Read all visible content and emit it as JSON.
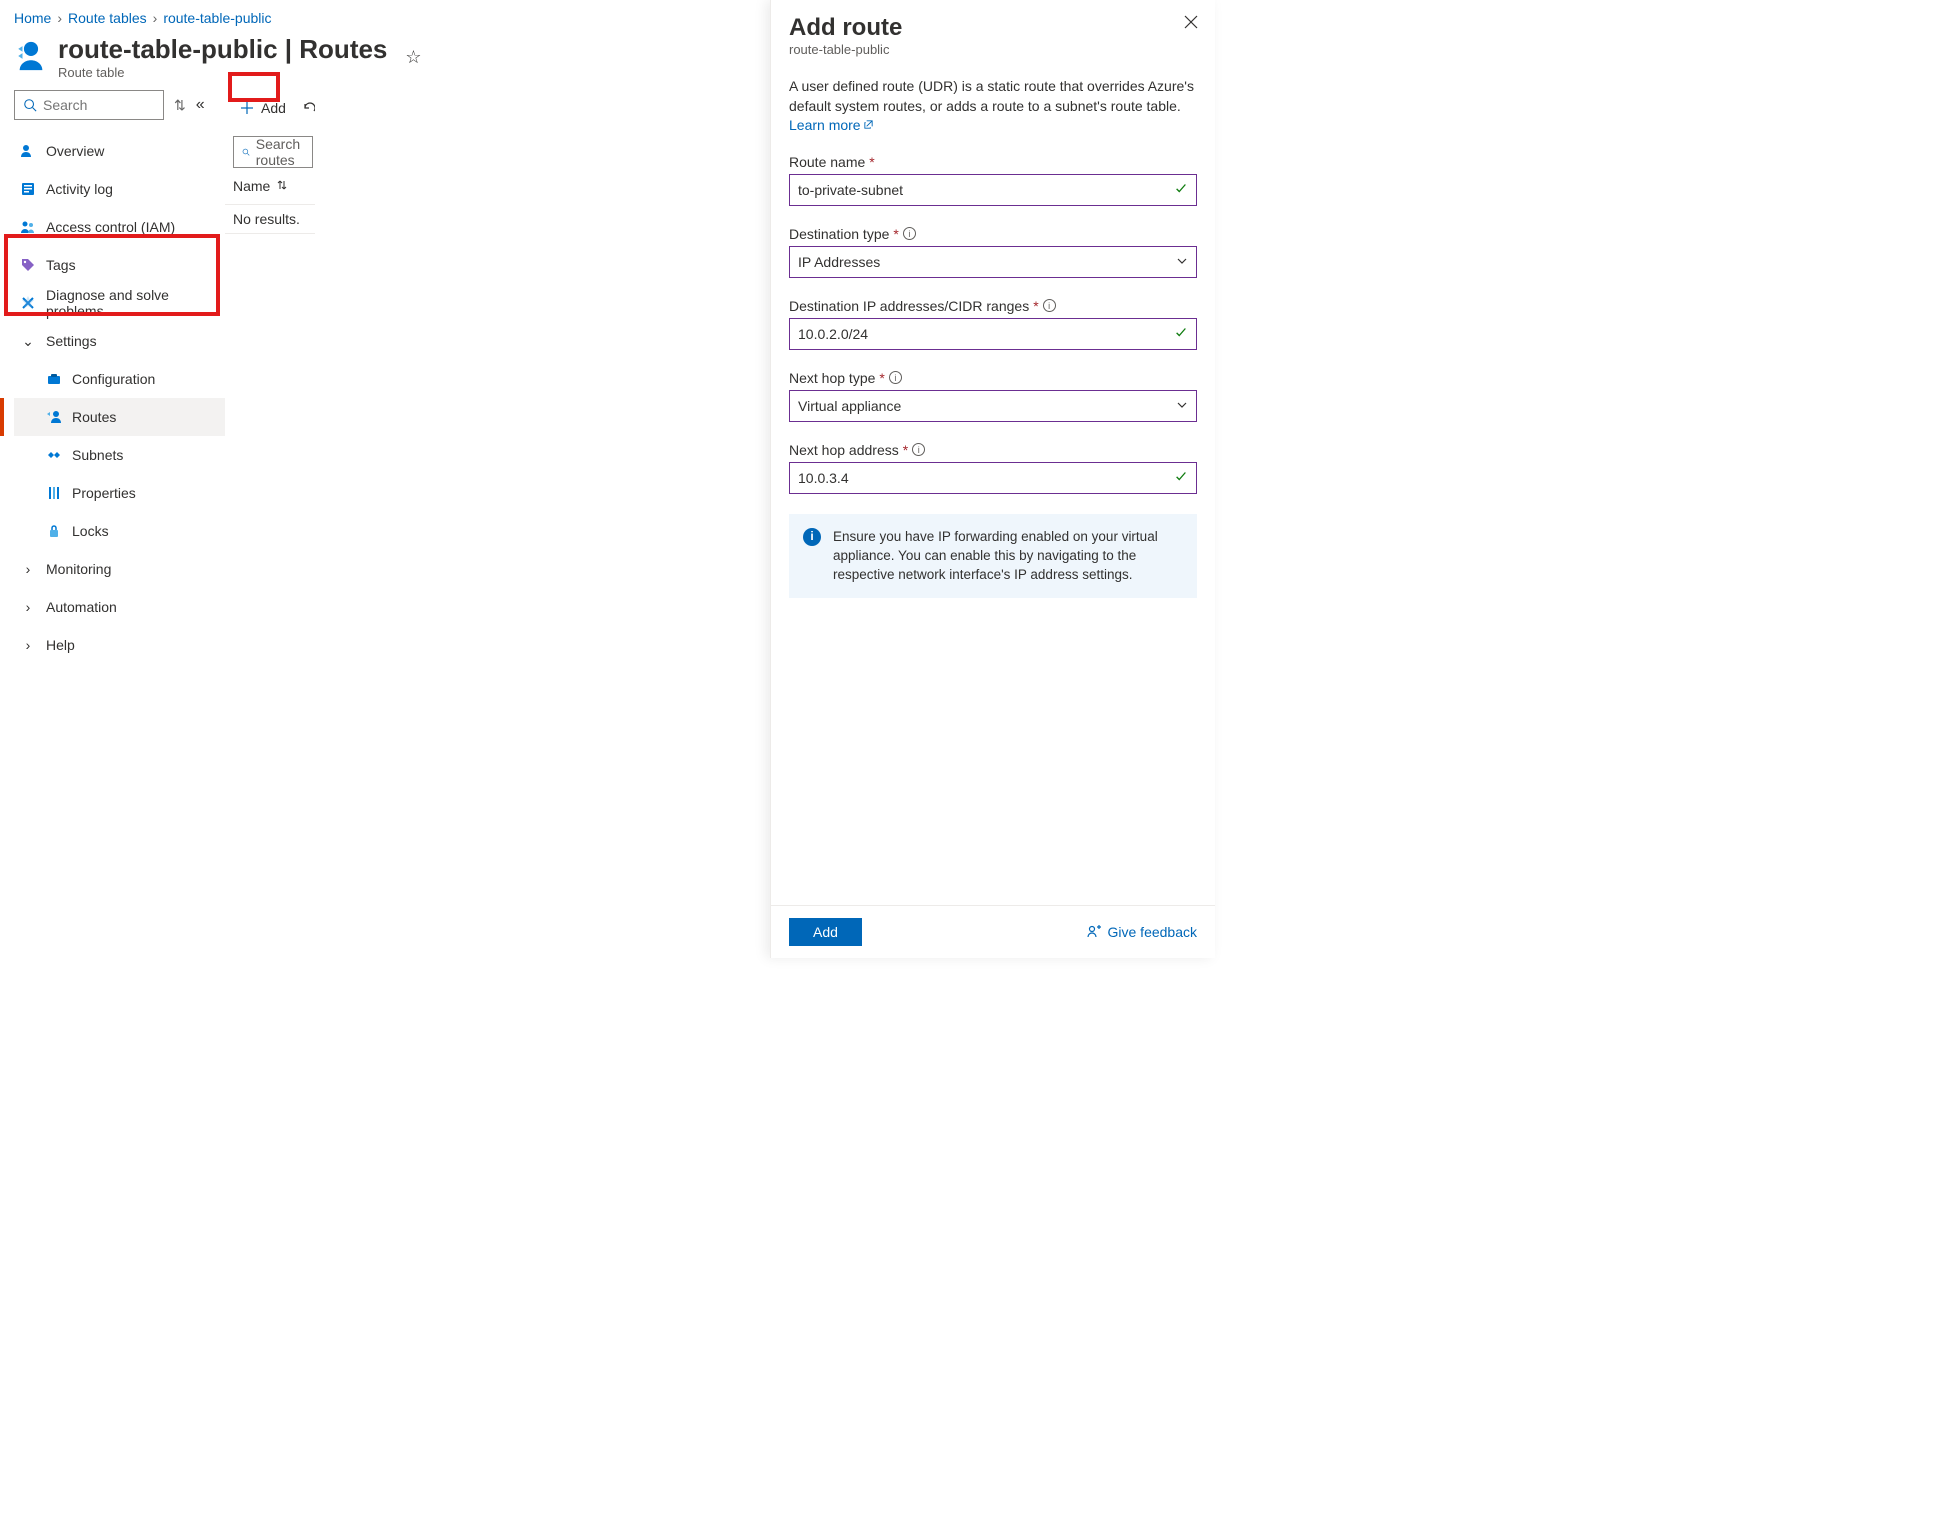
{
  "breadcrumb": {
    "home": "Home",
    "route_tables": "Route tables",
    "current": "route-table-public"
  },
  "header": {
    "title": "route-table-public | Routes",
    "subtitle": "Route table"
  },
  "sidebar": {
    "search_placeholder": "Search",
    "items": {
      "overview": "Overview",
      "activity": "Activity log",
      "iam": "Access control (IAM)",
      "tags": "Tags",
      "diagnose": "Diagnose and solve problems"
    },
    "settings_label": "Settings",
    "settings": {
      "configuration": "Configuration",
      "routes": "Routes",
      "subnets": "Subnets",
      "properties": "Properties",
      "locks": "Locks"
    },
    "monitoring": "Monitoring",
    "automation": "Automation",
    "help": "Help"
  },
  "toolbar": {
    "add": "Add",
    "refresh_initial": "R"
  },
  "table": {
    "search_placeholder": "Search routes",
    "col_name": "Name",
    "empty": "No results."
  },
  "panel": {
    "title": "Add route",
    "subtitle": "route-table-public",
    "description": "A user defined route (UDR) is a static route that overrides Azure's default system routes, or adds a route to a subnet's route table. ",
    "learn_more": "Learn more",
    "fields": {
      "route_name_label": "Route name",
      "route_name_value": "to-private-subnet",
      "dest_type_label": "Destination type",
      "dest_type_value": "IP Addresses",
      "cidr_label": "Destination IP addresses/CIDR ranges",
      "cidr_value": "10.0.2.0/24",
      "next_hop_type_label": "Next hop type",
      "next_hop_type_value": "Virtual appliance",
      "next_hop_addr_label": "Next hop address",
      "next_hop_addr_value": "10.0.3.4"
    },
    "info": "Ensure you have IP forwarding enabled on your virtual appliance. You can enable this by navigating to the respective network interface's IP address settings.",
    "add_button": "Add",
    "feedback": "Give feedback"
  }
}
